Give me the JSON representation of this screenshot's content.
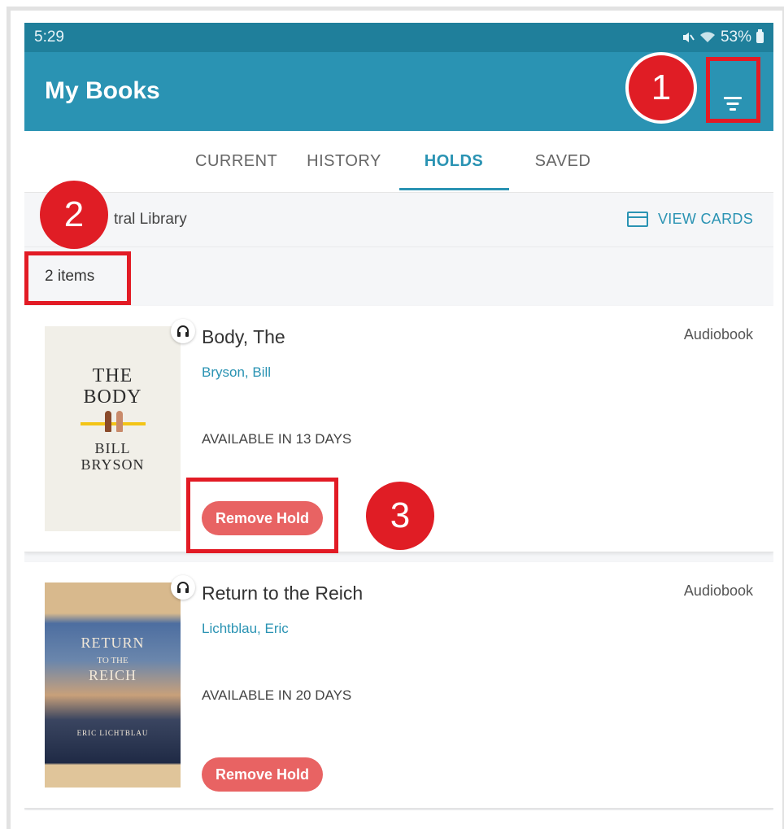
{
  "status_bar": {
    "time": "5:29",
    "battery": "53%"
  },
  "app_bar": {
    "title": "My Books"
  },
  "tabs": [
    {
      "label": "CURRENT",
      "active": false
    },
    {
      "label": "HISTORY",
      "active": false
    },
    {
      "label": "HOLDS",
      "active": true
    },
    {
      "label": "SAVED",
      "active": false
    }
  ],
  "library": {
    "name": "tral Library",
    "view_cards_label": "VIEW CARDS"
  },
  "item_count": "2 items",
  "books": [
    {
      "title": "Body, The",
      "author": "Bryson, Bill",
      "format": "Audiobook",
      "availability": "AVAILABLE IN 13 DAYS",
      "action_label": "Remove Hold",
      "cover": {
        "line1": "THE",
        "line2": "BODY",
        "line3": "BILL",
        "line4": "BRYSON"
      }
    },
    {
      "title": "Return to the Reich",
      "author": "Lichtblau, Eric",
      "format": "Audiobook",
      "availability": "AVAILABLE IN 20 DAYS",
      "action_label": "Remove Hold",
      "cover": {
        "line1": "RETURN",
        "line2": "TO THE",
        "line3": "REICH",
        "line4": "ERIC LICHTBLAU"
      }
    }
  ],
  "callouts": [
    "1",
    "2",
    "3"
  ],
  "colors": {
    "accent": "#2a93b3",
    "status_bar": "#1f7f9b",
    "remove_button": "#e86363",
    "callout_red": "#e01d25"
  },
  "icons": [
    "mute-icon",
    "wifi-icon",
    "battery-icon",
    "filter-icon",
    "card-icon",
    "headphones-icon"
  ]
}
